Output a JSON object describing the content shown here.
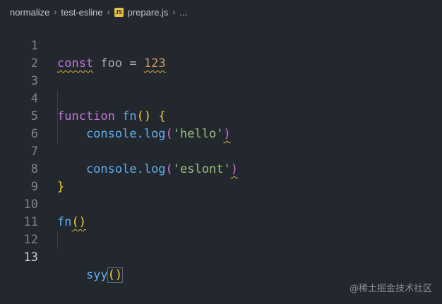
{
  "breadcrumb": {
    "items": [
      "normalize",
      "test-esline",
      "prepare.js",
      "..."
    ],
    "js_badge": "JS"
  },
  "editor": {
    "line_numbers": [
      "1",
      "2",
      "3",
      "4",
      "5",
      "6",
      "7",
      "8",
      "9",
      "10",
      "11",
      "12",
      "13"
    ],
    "lines": [
      [
        {
          "t": "const",
          "c": "kw"
        },
        {
          "t": " foo = ",
          "c": "plain"
        },
        {
          "t": "123",
          "c": "num"
        }
      ],
      [],
      [],
      [
        {
          "t": "function",
          "c": "kw"
        },
        {
          "t": " ",
          "c": "plain"
        },
        {
          "t": "fn",
          "c": "fn"
        },
        {
          "t": "() {",
          "c": "brace1"
        }
      ],
      [
        {
          "t": "    console.",
          "c": "plain"
        },
        {
          "t": "log",
          "c": "fn"
        },
        {
          "t": "(",
          "c": "brace2"
        },
        {
          "t": "'hello'",
          "c": "str"
        },
        {
          "t": ")",
          "c": "brace2"
        }
      ],
      [],
      [
        {
          "t": "    console.",
          "c": "plain"
        },
        {
          "t": "log",
          "c": "fn"
        },
        {
          "t": "(",
          "c": "brace2"
        },
        {
          "t": "'eslont'",
          "c": "str"
        },
        {
          "t": ")",
          "c": "brace2"
        }
      ],
      [
        {
          "t": "}",
          "c": "brace1"
        }
      ],
      [],
      [
        {
          "t": "fn",
          "c": "fn"
        },
        {
          "t": "()",
          "c": "brace1"
        }
      ],
      [],
      [],
      [
        {
          "t": "    syy",
          "c": "fn"
        },
        {
          "t": "()",
          "c": "brace1"
        }
      ]
    ]
  },
  "watermark": "@稀土掘金技术社区",
  "colors": {
    "background": "#23272e",
    "keyword": "#c678dd",
    "function": "#61afef",
    "number": "#d19a66",
    "string": "#98c379",
    "bracket": "#f7d13b",
    "bracket_nested": "#d670d6",
    "warning": "#d8b33a"
  }
}
